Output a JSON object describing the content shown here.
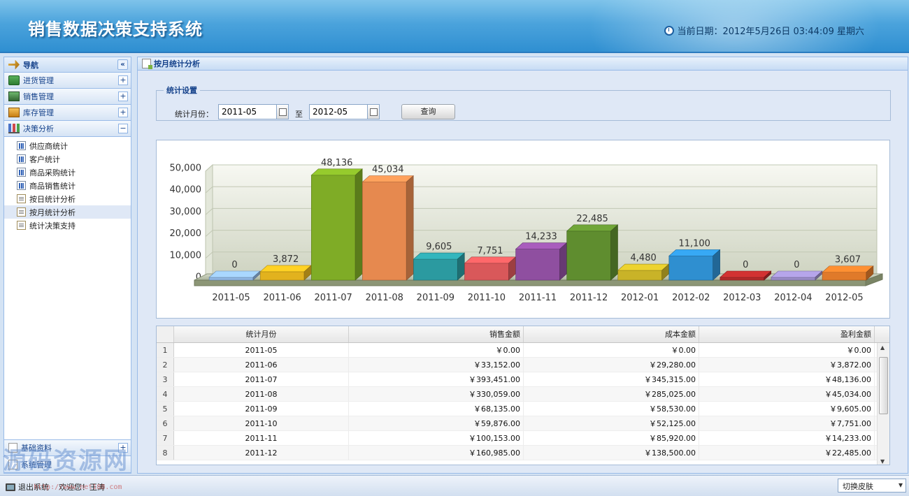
{
  "header": {
    "title": "销售数据决策支持系统",
    "date_text": "当前日期：2012年5月26日  03:44:09 星期六"
  },
  "nav": {
    "title": "导航",
    "collapse_glyph": "«",
    "sections": [
      {
        "label": "进货管理",
        "toggle": "+"
      },
      {
        "label": "销售管理",
        "toggle": "+"
      },
      {
        "label": "库存管理",
        "toggle": "+"
      },
      {
        "label": "决策分析",
        "toggle": "−"
      }
    ],
    "tree_items": [
      {
        "label": "供应商统计",
        "icon": "bar-chart-icon"
      },
      {
        "label": "客户统计",
        "icon": "bar-chart-icon"
      },
      {
        "label": "商品采购统计",
        "icon": "bar-chart-icon"
      },
      {
        "label": "商品销售统计",
        "icon": "bar-chart-icon"
      },
      {
        "label": "按日统计分析",
        "icon": "report-icon"
      },
      {
        "label": "按月统计分析",
        "icon": "report-icon"
      },
      {
        "label": "统计决策支持",
        "icon": "report-icon"
      }
    ],
    "bottom_sections": [
      {
        "label": "基础资料",
        "toggle": "+"
      },
      {
        "label": "系统管理",
        "toggle": ""
      }
    ]
  },
  "main": {
    "title": "按月统计分析",
    "settings": {
      "legend": "统计设置",
      "month_label": "统计月份：",
      "start_value": "2011-05",
      "to_label": "至",
      "end_value": "2012-05",
      "query_label": "查询"
    }
  },
  "chart_data": {
    "type": "bar",
    "categories": [
      "2011-05",
      "2011-06",
      "2011-07",
      "2011-08",
      "2011-09",
      "2011-10",
      "2011-11",
      "2011-12",
      "2012-01",
      "2012-02",
      "2012-03",
      "2012-04",
      "2012-05"
    ],
    "values": [
      0,
      3872,
      48136,
      45034,
      9605,
      7751,
      14233,
      22485,
      4480,
      11100,
      0,
      0,
      3607
    ],
    "value_labels": [
      "0",
      "3,872",
      "48,136",
      "45,034",
      "9,605",
      "7,751",
      "14,233",
      "22,485",
      "4,480",
      "11,100",
      "0",
      "0",
      "3,607"
    ],
    "ylim": [
      0,
      50000
    ],
    "yticks": [
      "0",
      "10,000",
      "20,000",
      "30,000",
      "40,000",
      "50,000"
    ],
    "bar_colors": [
      "#8fb6e3",
      "#e2b21e",
      "#7fac26",
      "#e6894f",
      "#2b9aa0",
      "#d9585a",
      "#8f4fa0",
      "#5f8d2f",
      "#c9b328",
      "#2f8fd0",
      "#b22a2a",
      "#9a8cc7",
      "#e07a2a"
    ],
    "grid": true,
    "style": "3d"
  },
  "grid": {
    "columns": [
      "统计月份",
      "销售金额",
      "成本金额",
      "盈利金额"
    ],
    "rows": [
      {
        "n": "1",
        "month": "2011-05",
        "sales": "￥0.00",
        "cost": "￥0.00",
        "profit": "￥0.00"
      },
      {
        "n": "2",
        "month": "2011-06",
        "sales": "￥33,152.00",
        "cost": "￥29,280.00",
        "profit": "￥3,872.00"
      },
      {
        "n": "3",
        "month": "2011-07",
        "sales": "￥393,451.00",
        "cost": "￥345,315.00",
        "profit": "￥48,136.00"
      },
      {
        "n": "4",
        "month": "2011-08",
        "sales": "￥330,059.00",
        "cost": "￥285,025.00",
        "profit": "￥45,034.00"
      },
      {
        "n": "5",
        "month": "2011-09",
        "sales": "￥68,135.00",
        "cost": "￥58,530.00",
        "profit": "￥9,605.00"
      },
      {
        "n": "6",
        "month": "2011-10",
        "sales": "￥59,876.00",
        "cost": "￥52,125.00",
        "profit": "￥7,751.00"
      },
      {
        "n": "7",
        "month": "2011-11",
        "sales": "￥100,153.00",
        "cost": "￥85,920.00",
        "profit": "￥14,233.00"
      },
      {
        "n": "8",
        "month": "2011-12",
        "sales": "￥160,985.00",
        "cost": "￥138,500.00",
        "profit": "￥22,485.00"
      }
    ]
  },
  "footer": {
    "exit_label": "退出系统",
    "welcome": "欢迎您！王涛",
    "skin_label": "切换皮肤"
  },
  "watermark": {
    "text": "源码资源网",
    "url": "http://www.net188.com"
  }
}
